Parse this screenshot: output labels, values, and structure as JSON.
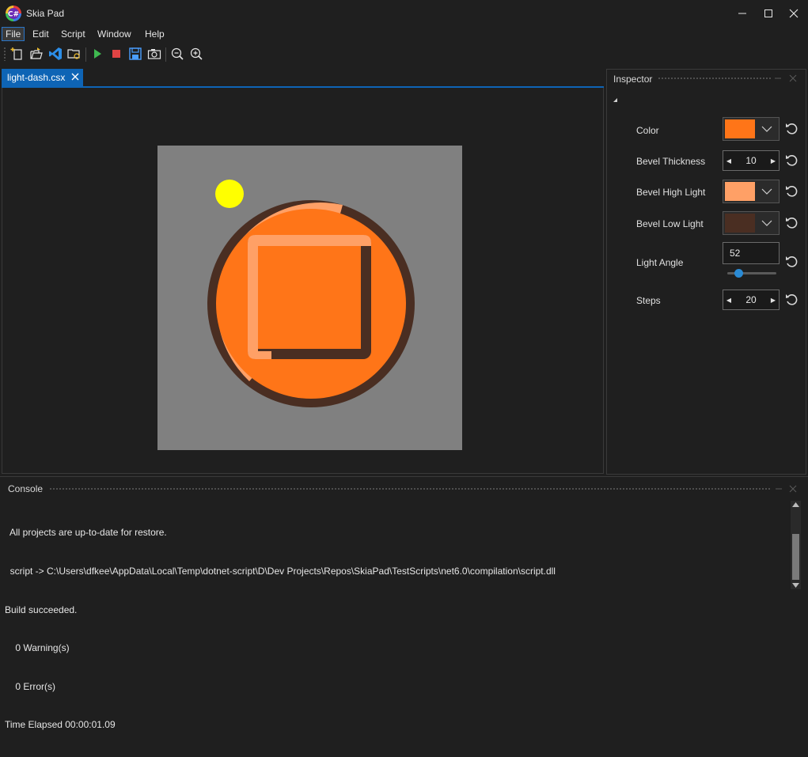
{
  "window": {
    "title": "Skia Pad",
    "minimize_icon": "minimize-icon",
    "maximize_icon": "maximize-icon",
    "close_icon": "close-icon"
  },
  "menu": {
    "items": [
      {
        "label": "File"
      },
      {
        "label": "Edit"
      },
      {
        "label": "Script"
      },
      {
        "label": "Window"
      },
      {
        "label": "Help"
      }
    ]
  },
  "toolbar": {
    "buttons": [
      {
        "icon": "new-file-icon"
      },
      {
        "icon": "open-folder-icon"
      },
      {
        "icon": "vscode-icon"
      },
      {
        "icon": "browse-folder-icon"
      },
      {
        "icon": "run-icon"
      },
      {
        "icon": "stop-icon"
      },
      {
        "icon": "save-icon"
      },
      {
        "icon": "screenshot-icon"
      },
      {
        "icon": "zoom-out-icon"
      },
      {
        "icon": "zoom-in-icon"
      }
    ]
  },
  "editor": {
    "tab_label": "light-dash.csx",
    "preview_colors": {
      "background": "#808080",
      "face": "#ff7518",
      "highlight": "#ffa066",
      "lowlight": "#4a2e22",
      "sun": "#ffff00"
    }
  },
  "inspector": {
    "title": "Inspector",
    "properties": [
      {
        "label": "Color",
        "type": "color",
        "value": "#ff7518"
      },
      {
        "label": "Bevel Thickness",
        "type": "number",
        "value": "10"
      },
      {
        "label": "Bevel High Light",
        "type": "color",
        "value": "#ffa066"
      },
      {
        "label": "Bevel Low Light",
        "type": "color",
        "value": "#4a2e22"
      },
      {
        "label": "Light Angle",
        "type": "slider",
        "value": "52",
        "slider_fraction": 0.18
      },
      {
        "label": "Steps",
        "type": "number",
        "value": "20"
      }
    ]
  },
  "console": {
    "title": "Console",
    "lines": [
      "  All projects are up-to-date for restore.",
      "  script -> C:\\Users\\dfkee\\AppData\\Local\\Temp\\dotnet-script\\D\\Dev Projects\\Repos\\SkiaPad\\TestScripts\\net6.0\\compilation\\script.dll",
      "Build succeeded.",
      "    0 Warning(s)",
      "    0 Error(s)",
      "Time Elapsed 00:00:01.09"
    ]
  }
}
